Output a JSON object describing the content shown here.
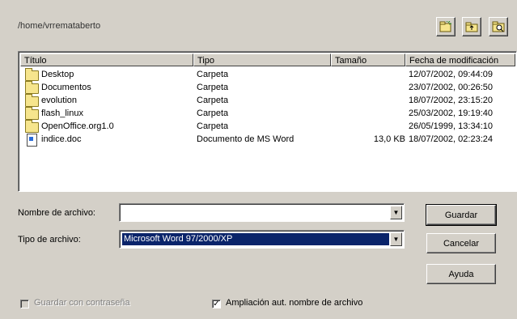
{
  "path": "/home/vrremataberto",
  "toolbar": {
    "new_folder": "new-folder-icon",
    "up_folder": "up-folder-icon",
    "default_dir": "default-directory-icon"
  },
  "columns": [
    "Título",
    "Tipo",
    "Tamaño",
    "Fecha de modificación"
  ],
  "files": [
    {
      "name": "Desktop",
      "type": "Carpeta",
      "size": "",
      "date": "12/07/2002, 09:44:09",
      "icon": "folder-icon"
    },
    {
      "name": "Documentos",
      "type": "Carpeta",
      "size": "",
      "date": "23/07/2002, 00:26:50",
      "icon": "folder-icon"
    },
    {
      "name": "evolution",
      "type": "Carpeta",
      "size": "",
      "date": "18/07/2002, 23:15:20",
      "icon": "folder-icon"
    },
    {
      "name": "flash_linux",
      "type": "Carpeta",
      "size": "",
      "date": "25/03/2002, 19:19:40",
      "icon": "folder-icon"
    },
    {
      "name": "OpenOffice.org1.0",
      "type": "Carpeta",
      "size": "",
      "date": "26/05/1999, 13:34:10",
      "icon": "folder-icon"
    },
    {
      "name": "indice.doc",
      "type": "Documento de MS Word",
      "size": "13,0 KB",
      "date": "18/07/2002, 02:23:24",
      "icon": "word-document-icon"
    }
  ],
  "filename": {
    "label": "Nombre de archivo:",
    "value": ""
  },
  "filetype": {
    "label": "Tipo de archivo:",
    "value": "Microsoft Word 97/2000/XP"
  },
  "buttons": {
    "save": "Guardar",
    "cancel": "Cancelar",
    "help": "Ayuda"
  },
  "checkboxes": {
    "password": {
      "label": "Guardar con contraseña",
      "checked": false,
      "enabled": false
    },
    "extension": {
      "label": "Ampliación aut. nombre de archivo",
      "checked": true,
      "enabled": true
    }
  }
}
